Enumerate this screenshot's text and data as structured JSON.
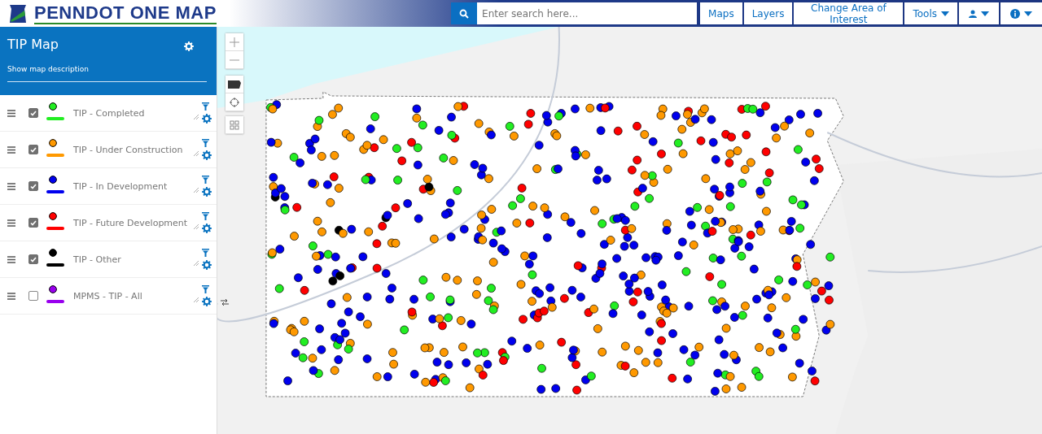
{
  "header": {
    "logo_text": "PENNDOT ONE MAP",
    "search": {
      "placeholder": "Enter search here..."
    },
    "nav": [
      {
        "kind": "text",
        "label": "Maps"
      },
      {
        "kind": "text",
        "label": "Layers"
      },
      {
        "kind": "text",
        "label": "Change Area of Interest"
      },
      {
        "kind": "dropdown",
        "label": "Tools"
      },
      {
        "kind": "user"
      },
      {
        "kind": "info"
      }
    ]
  },
  "sidebar": {
    "title": "TIP Map",
    "description_link": "Show map description",
    "layers": [
      {
        "name": "TIP - Completed",
        "checked": true,
        "color": "#22ee22"
      },
      {
        "name": "TIP - Under Construction",
        "checked": true,
        "color": "#ff9900"
      },
      {
        "name": "TIP - In Development",
        "checked": true,
        "color": "#0000ee"
      },
      {
        "name": "TIP - Future Development",
        "checked": true,
        "color": "#ff0000"
      },
      {
        "name": "TIP - Other",
        "checked": true,
        "color": "#000000"
      },
      {
        "name": "MPMS - TIP - All",
        "checked": false,
        "color": "#9900ee"
      }
    ]
  }
}
